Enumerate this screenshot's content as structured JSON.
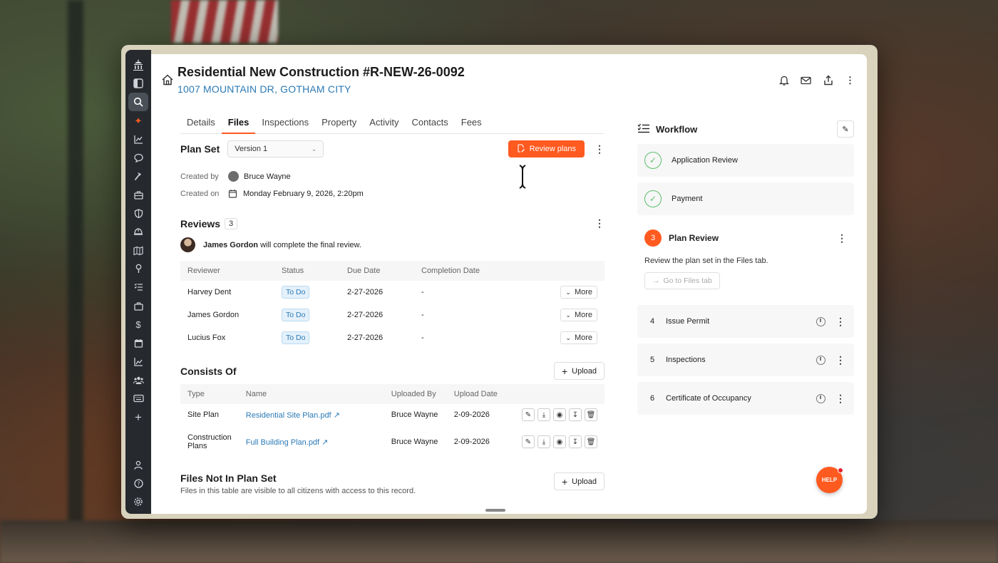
{
  "record": {
    "title": "Residential New Construction #R-NEW-26-0092",
    "address": "1007 MOUNTAIN DR, GOTHAM CITY"
  },
  "tabs": [
    "Details",
    "Files",
    "Inspections",
    "Property",
    "Activity",
    "Contacts",
    "Fees"
  ],
  "active_tab": "Files",
  "plan_set": {
    "heading": "Plan Set",
    "version": "Version 1",
    "review_button": "Review plans",
    "created_by_label": "Created by",
    "created_by": "Bruce Wayne",
    "created_on_label": "Created on",
    "created_on": "Monday February 9, 2026, 2:20pm"
  },
  "reviews": {
    "heading": "Reviews",
    "count": "3",
    "final_reviewer": "James Gordon",
    "final_note": "will complete the final review.",
    "columns": [
      "Reviewer",
      "Status",
      "Due Date",
      "Completion Date"
    ],
    "rows": [
      {
        "reviewer": "Harvey Dent",
        "status": "To Do",
        "due": "2-27-2026",
        "completed": "-",
        "action": "More"
      },
      {
        "reviewer": "James Gordon",
        "status": "To Do",
        "due": "2-27-2026",
        "completed": "-",
        "action": "More"
      },
      {
        "reviewer": "Lucius Fox",
        "status": "To Do",
        "due": "2-27-2026",
        "completed": "-",
        "action": "More"
      }
    ]
  },
  "consists_of": {
    "heading": "Consists Of",
    "upload_label": "Upload",
    "columns": [
      "Type",
      "Name",
      "Uploaded By",
      "Upload Date"
    ],
    "rows": [
      {
        "type": "Site Plan",
        "name": "Residential Site Plan.pdf",
        "by": "Bruce Wayne",
        "date": "2-09-2026"
      },
      {
        "type": "Construction Plans",
        "name": "Full Building Plan.pdf",
        "by": "Bruce Wayne",
        "date": "2-09-2026"
      }
    ]
  },
  "files_not_in_set": {
    "heading": "Files Not In Plan Set",
    "description": "Files in this table are visible to all citizens with access to this record.",
    "upload_label": "Upload"
  },
  "workflow": {
    "heading": "Workflow",
    "completed": [
      "Application Review",
      "Payment"
    ],
    "active": {
      "number": "3",
      "name": "Plan Review",
      "description": "Review the plan set in the Files tab.",
      "button": "Go to Files tab"
    },
    "upcoming": [
      {
        "number": "4",
        "name": "Issue Permit"
      },
      {
        "number": "5",
        "name": "Inspections"
      },
      {
        "number": "6",
        "name": "Certificate of Occupancy"
      }
    ]
  },
  "help": {
    "label": "HELP"
  },
  "colors": {
    "accent": "#ff5a1f",
    "link": "#2b7ab5",
    "success": "#5bbf6b",
    "sidebar": "#262a2f"
  },
  "sidebar_icons": [
    "capitol-icon",
    "panel-icon",
    "search-icon",
    "sparkle-icon",
    "chart-icon",
    "chat-icon",
    "hammer-icon",
    "briefcase-icon",
    "shield-icon",
    "helmet-icon",
    "map-icon",
    "pin-icon",
    "checklist-icon",
    "toolbox-icon",
    "dollar-icon",
    "calendar-icon",
    "analytics-icon",
    "team-icon",
    "keyboard-icon",
    "plus-icon",
    "user-icon",
    "help-circle-icon",
    "settings-icon"
  ]
}
